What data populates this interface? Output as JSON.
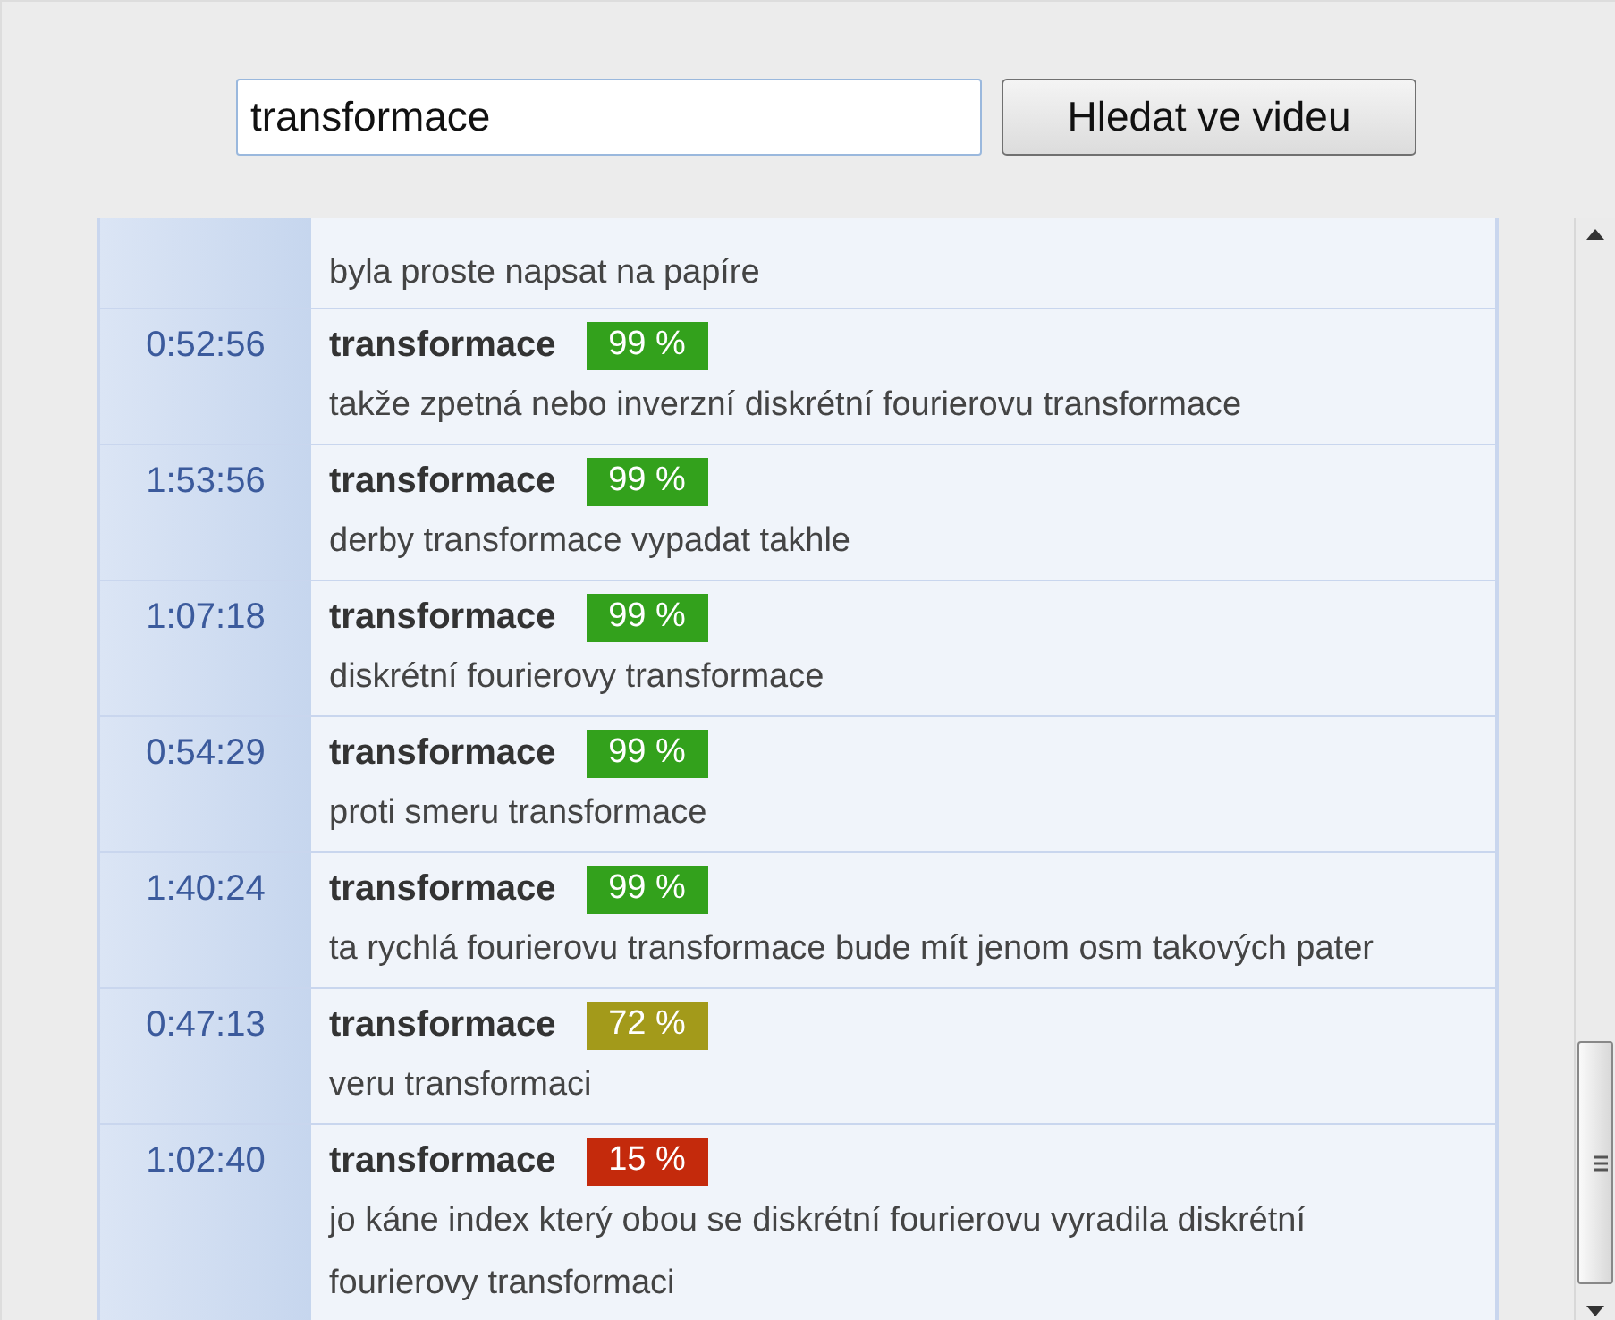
{
  "search": {
    "value": "transformace",
    "button": "Hledat ve videu"
  },
  "results": [
    {
      "kind": "continuation",
      "text": "byla proste napsat na papíre"
    },
    {
      "kind": "hit",
      "time": "0:52:56",
      "word": "transformace",
      "score": "99 %",
      "color": "#33a11c",
      "text": "takže zpetná nebo inverzní diskrétní fourierovu transformace"
    },
    {
      "kind": "hit",
      "time": "1:53:56",
      "word": "transformace",
      "score": "99 %",
      "color": "#33a11c",
      "text": "derby transformace vypadat takhle"
    },
    {
      "kind": "hit",
      "time": "1:07:18",
      "word": "transformace",
      "score": "99 %",
      "color": "#33a11c",
      "text": "diskrétní fourierovy transformace"
    },
    {
      "kind": "hit",
      "time": "0:54:29",
      "word": "transformace",
      "score": "99 %",
      "color": "#33a11c",
      "text": "proti smeru transformace"
    },
    {
      "kind": "hit",
      "time": "1:40:24",
      "word": "transformace",
      "score": "99 %",
      "color": "#33a11c",
      "text": "ta rychlá fourierovu transformace bude mít jenom osm takových pater"
    },
    {
      "kind": "hit",
      "time": "0:47:13",
      "word": "transformace",
      "score": "72 %",
      "color": "#a39a1a",
      "text": "veru transformaci"
    },
    {
      "kind": "hit",
      "time": "1:02:40",
      "word": "transformace",
      "score": "15 %",
      "color": "#c42a0c",
      "text": "jo káne index který obou se diskrétní fourierovu vyradila diskrétní fourierovy transformaci"
    }
  ]
}
